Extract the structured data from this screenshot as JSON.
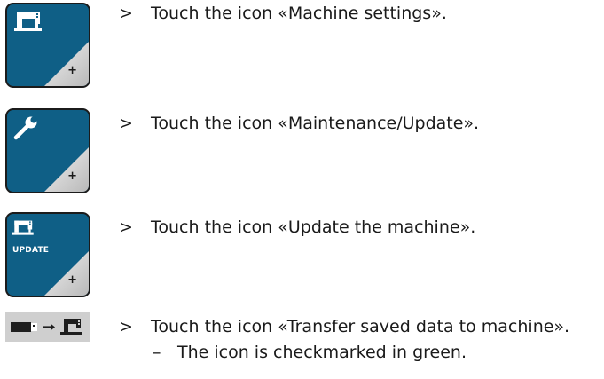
{
  "steps": [
    {
      "marker": ">",
      "text": "Touch the icon «Machine settings»."
    },
    {
      "marker": ">",
      "text": "Touch the icon «Maintenance/Update»."
    },
    {
      "marker": ">",
      "text": "Touch the icon «Update the machine»."
    },
    {
      "marker": ">",
      "text": "Touch the icon «Transfer saved data to machine»."
    }
  ],
  "result": {
    "marker": "–",
    "text": "The icon is checkmarked in green."
  },
  "icons": {
    "machine_settings": "sewing-machine-icon",
    "maintenance": "wrench-icon",
    "update": "sewing-machine-icon",
    "update_label": "UPDATE",
    "transfer": "usb-to-machine-icon",
    "plus": "+"
  },
  "colors": {
    "tile_bg": "#0f5f86",
    "tile_border": "#1b1b1b",
    "transfer_bg": "#cfcfcf"
  }
}
